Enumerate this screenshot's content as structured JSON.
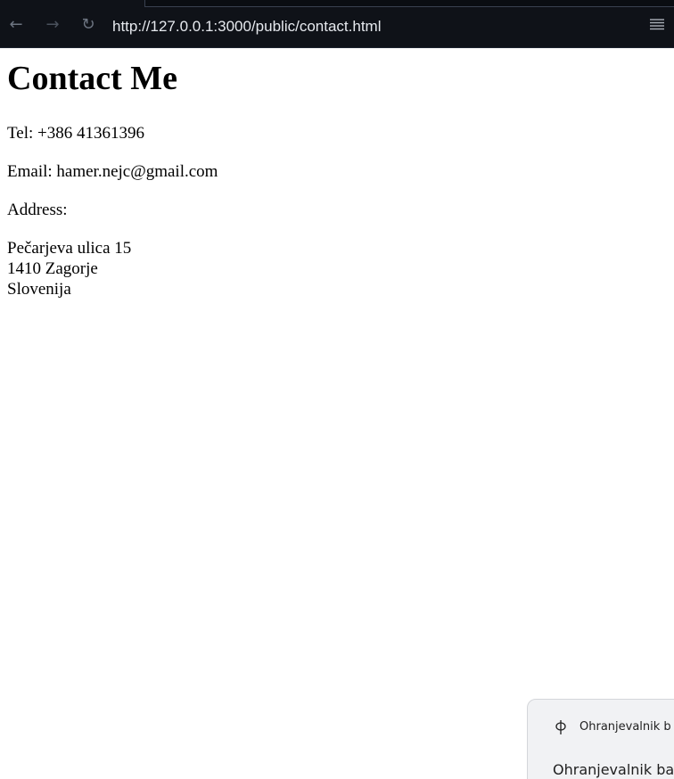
{
  "browser": {
    "url": "http://127.0.0.1:3000/public/contact.html",
    "icons": {
      "back": "back-arrow-icon",
      "forward": "forward-arrow-icon",
      "reload": "reload-icon",
      "menu": "menu-icon"
    },
    "colors": {
      "toolbar_bg": "#0f1218",
      "url_text": "#e6e9ee"
    }
  },
  "page": {
    "title": "Contact Me",
    "tel": "Tel: +386 41361396",
    "email": "Email: hamer.nejc@gmail.com",
    "address_label": "Address:",
    "address_lines": [
      "Pečarjeva ulica 15",
      "1410 Zagorje",
      "Slovenija"
    ]
  },
  "notification": {
    "app_name": "Ohranjevalnik b",
    "title": "Ohranjevalnik bat",
    "icon": "battery-saver-icon"
  }
}
